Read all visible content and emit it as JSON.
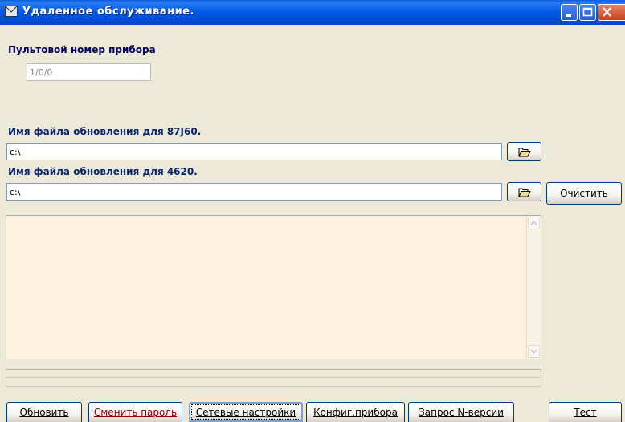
{
  "window": {
    "title": "Удаленное обслуживание.",
    "controls": [
      "minimize",
      "maximize",
      "close"
    ]
  },
  "device": {
    "label": "Пультовой  номер прибора",
    "value": "1/0/0"
  },
  "update_87j60": {
    "label": "Имя файла обновления для 87J60.",
    "path": "c:\\"
  },
  "update_4620": {
    "label": "Имя файла обновления для 4620.",
    "path": "c:\\"
  },
  "buttons": {
    "clear": "Очистить",
    "refresh": "Обновить",
    "change_password": "Сменить пароль",
    "network_settings": "Сетевые настройки",
    "device_config": "Конфиг.прибора",
    "version_request": "Запрос N-версии",
    "test": "Тест"
  },
  "icons": {
    "open_folder": "folder-open-icon",
    "app": "envelope-icon"
  },
  "colors": {
    "titlebar": "#0058e6",
    "label": "#0a246a",
    "log_background": "#fdf2dd",
    "window_background": "#ece9d8"
  }
}
